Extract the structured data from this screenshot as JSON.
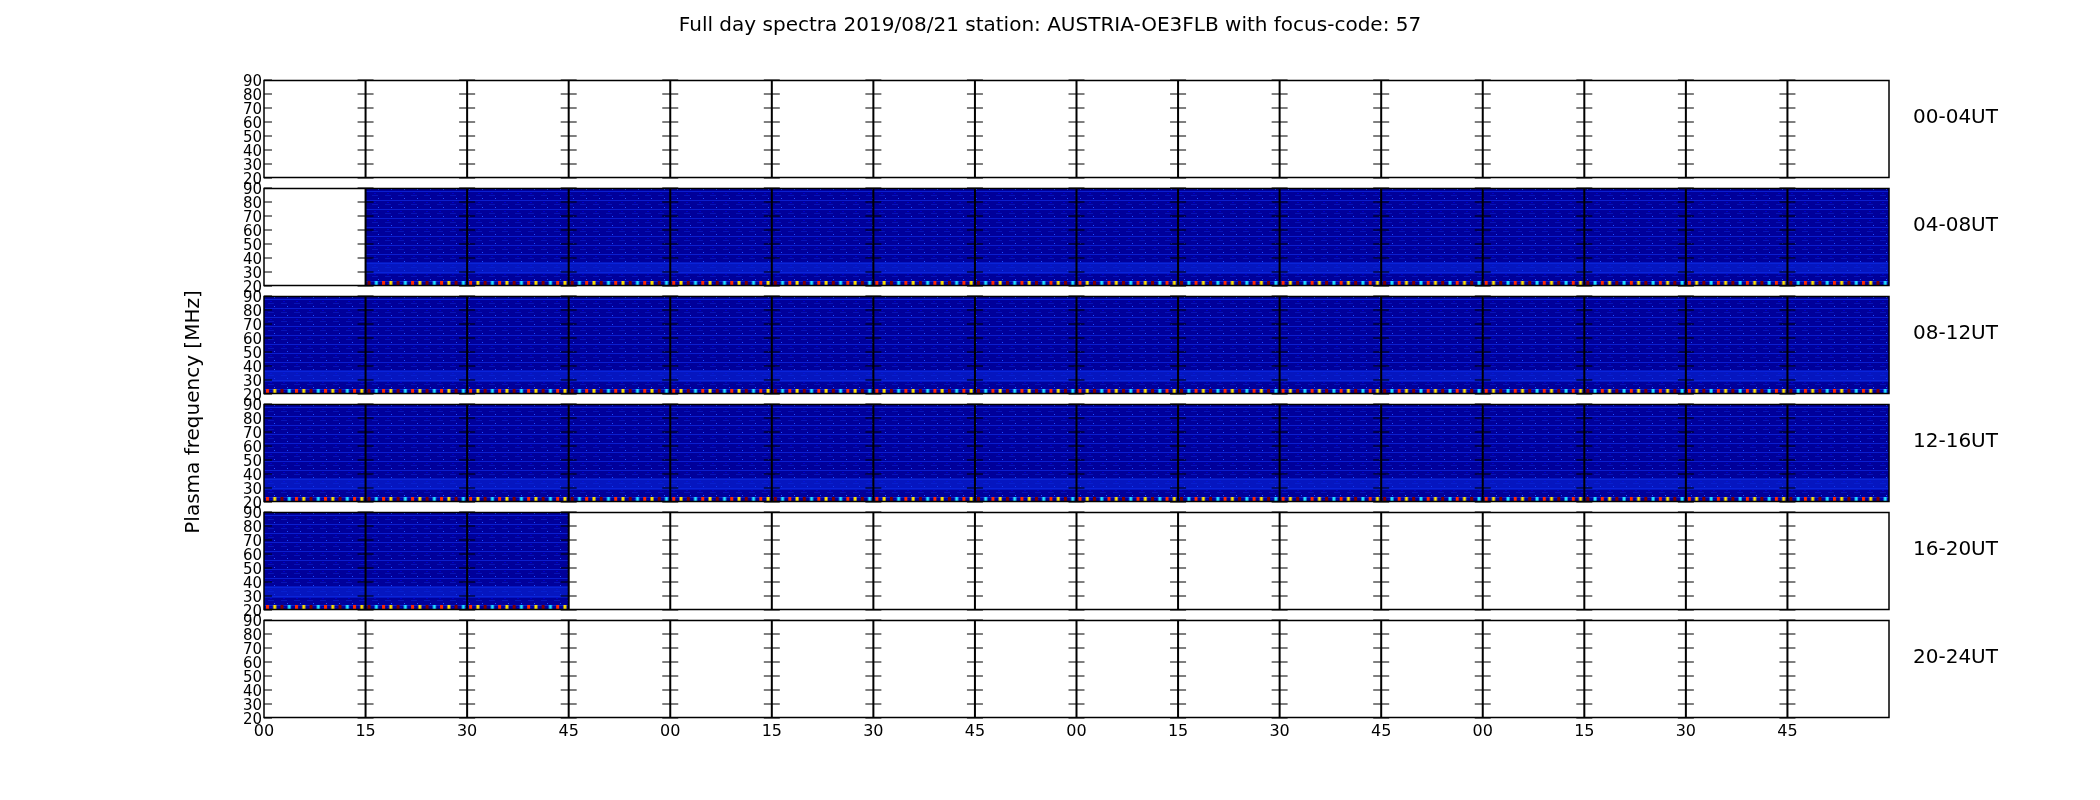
{
  "title": "Full day spectra 2019/08/21 station: AUSTRIA-OE3FLB with focus-code: 57",
  "ylabel": "Plasma frequency [MHz]",
  "panels": [
    {
      "label": "00-04UT",
      "kind": "empty",
      "yticks": [
        "90",
        "80",
        "70",
        "60",
        "50",
        "40",
        "30",
        "20"
      ]
    },
    {
      "label": "04-08UT",
      "kind": "late_start",
      "yticks": [
        "90",
        "80",
        "70",
        "60",
        "50",
        "40",
        "30",
        "20"
      ]
    },
    {
      "label": "08-12UT",
      "kind": "full",
      "yticks": [
        "90",
        "80",
        "70",
        "60",
        "50",
        "40",
        "30",
        "20"
      ]
    },
    {
      "label": "12-16UT",
      "kind": "full",
      "yticks": [
        "90",
        "80",
        "70",
        "60",
        "50",
        "40",
        "30",
        "20"
      ]
    },
    {
      "label": "16-20UT",
      "kind": "early_end",
      "yticks": [
        "90",
        "80",
        "70",
        "60",
        "50",
        "40",
        "30",
        "20"
      ]
    },
    {
      "label": "20-24UT",
      "kind": "empty",
      "yticks": [
        "90",
        "80",
        "70",
        "60",
        "50",
        "40",
        "30",
        "20"
      ]
    }
  ],
  "xticks": [
    "00",
    "15",
    "30",
    "45",
    "00",
    "15",
    "30",
    "45",
    "00",
    "15",
    "30",
    "45",
    "00",
    "15",
    "30",
    "45"
  ]
}
